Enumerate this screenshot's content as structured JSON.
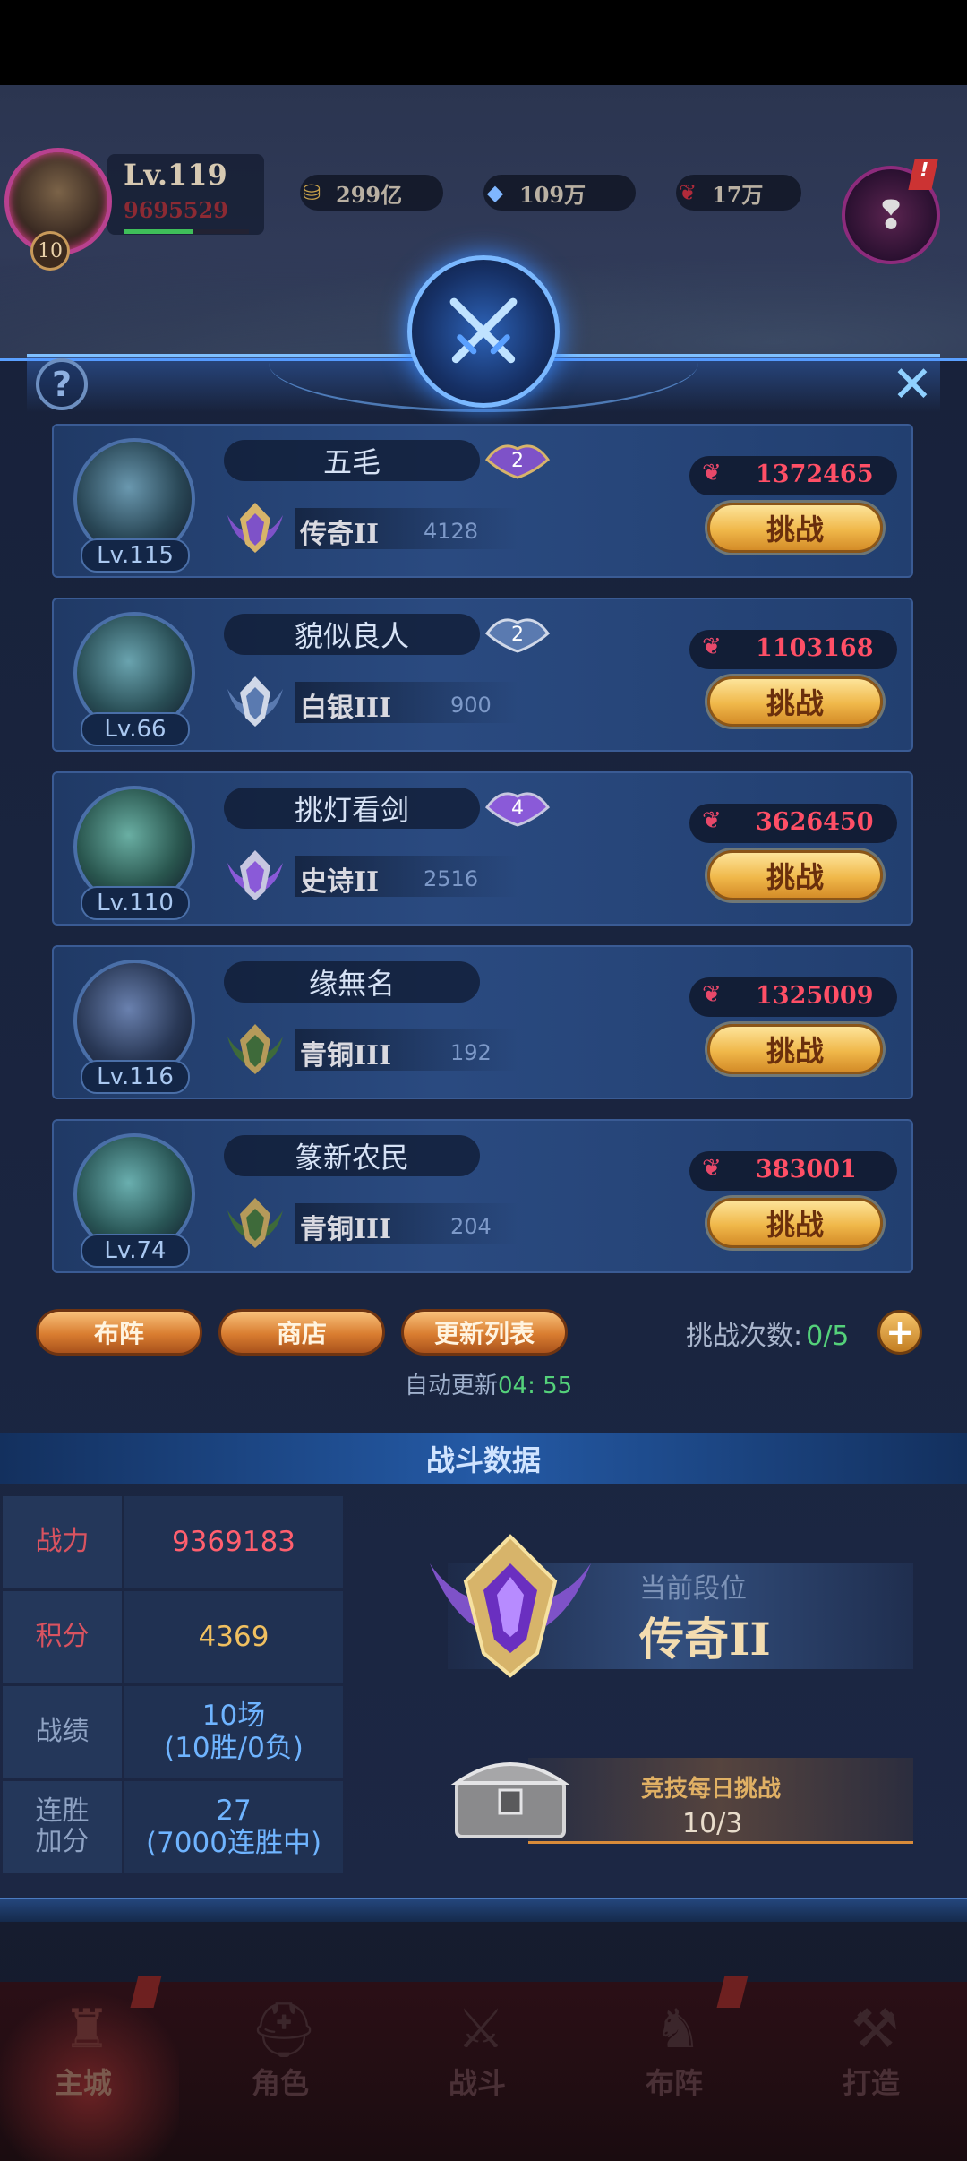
{
  "hud": {
    "level": "Lv.119",
    "power": "9695529",
    "vip": "10",
    "exp_fraction": 0.55,
    "resources": [
      {
        "icon": "gold-coin-icon",
        "value": "299亿"
      },
      {
        "icon": "diamond-icon",
        "value": "109万"
      },
      {
        "icon": "ruby-feather-icon",
        "value": "17万"
      }
    ]
  },
  "panel": {
    "help_label": "?",
    "close_label": "✕"
  },
  "opponents": [
    {
      "name": "五毛",
      "level": "Lv.115",
      "star_badge": "2",
      "rank": "传奇II",
      "points": "4128",
      "power": "1372465",
      "challenge_label": "挑战",
      "rank_tier": "legend"
    },
    {
      "name": "貌似良人",
      "level": "Lv.66",
      "star_badge": "2",
      "rank": "白银III",
      "points": "900",
      "power": "1103168",
      "challenge_label": "挑战",
      "rank_tier": "silver"
    },
    {
      "name": "挑灯看剑",
      "level": "Lv.110",
      "star_badge": "4",
      "rank": "史诗II",
      "points": "2516",
      "power": "3626450",
      "challenge_label": "挑战",
      "rank_tier": "epic"
    },
    {
      "name": "缘無名",
      "level": "Lv.116",
      "star_badge": "",
      "rank": "青铜III",
      "points": "192",
      "power": "1325009",
      "challenge_label": "挑战",
      "rank_tier": "bronze"
    },
    {
      "name": "篆新农民",
      "level": "Lv.74",
      "star_badge": "",
      "rank": "青铜III",
      "points": "204",
      "power": "383001",
      "challenge_label": "挑战",
      "rank_tier": "bronze"
    }
  ],
  "actions": {
    "lineup": "布阵",
    "shop": "商店",
    "refresh_list": "更新列表",
    "challenge_count_label": "挑战次数:",
    "challenge_count_value": "0/5",
    "plus": "+",
    "auto_refresh_label": "自动更新",
    "auto_refresh_time": "04: 55"
  },
  "battle_data": {
    "title": "战斗数据",
    "rows": [
      {
        "key": "战力",
        "line1": "9369183",
        "line2": ""
      },
      {
        "key": "积分",
        "line1": "4369",
        "line2": ""
      },
      {
        "key": "战绩",
        "line1": "10场",
        "line2": "(10胜/0负)"
      },
      {
        "key": "连胜\n加分",
        "line1": "27",
        "line2": "(7000连胜中)"
      }
    ],
    "current_rank_label": "当前段位",
    "current_rank": "传奇II",
    "daily_title": "竞技每日挑战",
    "daily_value": "10/3"
  },
  "nav": [
    {
      "label": "主城",
      "icon": "castle-icon",
      "active": true
    },
    {
      "label": "角色",
      "icon": "helmet-icon",
      "active": false
    },
    {
      "label": "战斗",
      "icon": "crossed-swords-icon",
      "active": false
    },
    {
      "label": "布阵",
      "icon": "formation-icon",
      "active": false
    },
    {
      "label": "打造",
      "icon": "anvil-icon",
      "active": false
    }
  ],
  "colors": {
    "power_red": "#ff4f66",
    "count_green": "#54d17a",
    "button_gold": "#f0b84a",
    "panel_blue": "#1a2540"
  }
}
